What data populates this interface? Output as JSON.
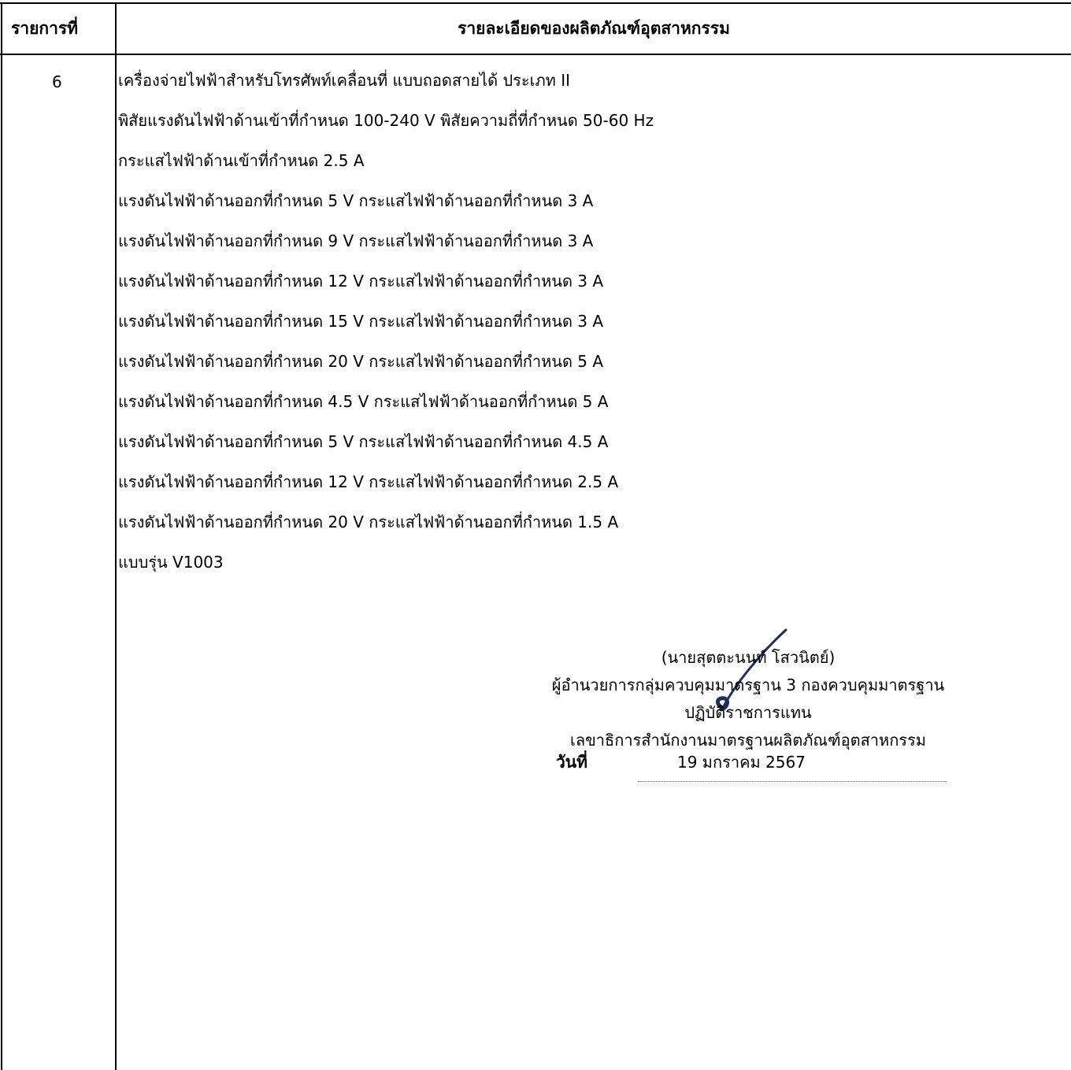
{
  "table": {
    "headers": {
      "item_no": "รายการที่",
      "detail": "รายละเอียดของผลิตภัณฑ์อุตสาหกรรม"
    },
    "row": {
      "item_no": "6",
      "lines": [
        "เครื่องจ่ายไฟฟ้าสำหรับโทรศัพท์เคลื่อนที่ แบบถอดสายได้  ประเภท II",
        "พิสัยแรงดันไฟฟ้าด้านเข้าที่กำหนด 100-240 V พิสัยความถี่ที่กำหนด 50-60 Hz",
        "กระแสไฟฟ้าด้านเข้าที่กำหนด 2.5 A",
        "แรงดันไฟฟ้าด้านออกที่กำหนด 5 V กระแสไฟฟ้าด้านออกที่กำหนด 3 A",
        "แรงดันไฟฟ้าด้านออกที่กำหนด 9 V กระแสไฟฟ้าด้านออกที่กำหนด 3 A",
        "แรงดันไฟฟ้าด้านออกที่กำหนด 12 V กระแสไฟฟ้าด้านออกที่กำหนด 3 A",
        "แรงดันไฟฟ้าด้านออกที่กำหนด 15 V กระแสไฟฟ้าด้านออกที่กำหนด 3 A",
        "แรงดันไฟฟ้าด้านออกที่กำหนด 20 V กระแสไฟฟ้าด้านออกที่กำหนด 5 A",
        "แรงดันไฟฟ้าด้านออกที่กำหนด 4.5 V กระแสไฟฟ้าด้านออกที่กำหนด 5 A",
        "แรงดันไฟฟ้าด้านออกที่กำหนด 5 V กระแสไฟฟ้าด้านออกที่กำหนด 4.5 A",
        "แรงดันไฟฟ้าด้านออกที่กำหนด 12 V กระแสไฟฟ้าด้านออกที่กำหนด 2.5 A",
        "แรงดันไฟฟ้าด้านออกที่กำหนด 20 V กระแสไฟฟ้าด้านออกที่กำหนด 1.5 A",
        "แบบรุ่น V1003"
      ]
    }
  },
  "signature_block": {
    "signature_icon": "handwritten-signature",
    "name": "(นายสุตตะนนท์ โสวนิตย์)",
    "position": "ผู้อำนวยการกลุ่มควบคุมมาตรฐาน 3 กองควบคุมมาตรฐาน",
    "acting": "ปฏิบัติราชการแทน",
    "office": "เลขาธิการสำนักงานมาตรฐานผลิตภัณฑ์อุตสาหกรรม",
    "date_label": "วันที่",
    "date_value": "19 มกราคม 2567"
  },
  "colors": {
    "text": "#000000",
    "border": "#000000",
    "signature_ink": "#1f2f5c"
  }
}
